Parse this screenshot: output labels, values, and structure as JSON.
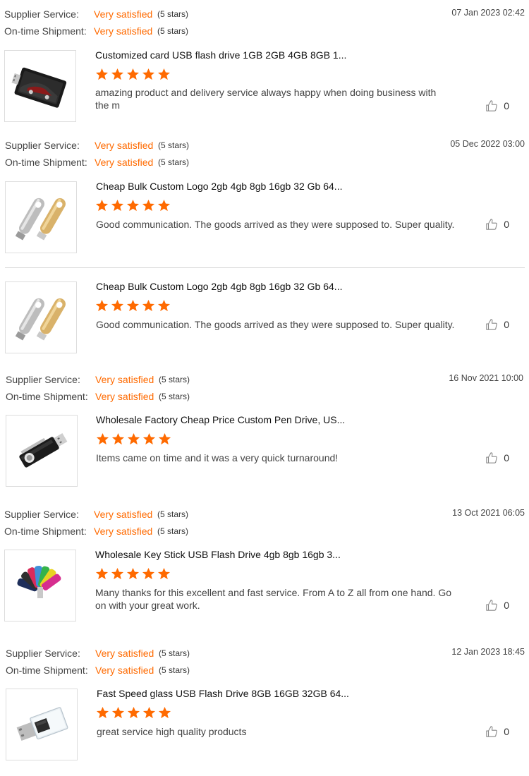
{
  "labels": {
    "supplier_service": "Supplier Service:",
    "ontime_shipment": "On-time Shipment:"
  },
  "reviews": [
    {
      "supplier_service": "Very satisfied",
      "supplier_stars": "(5 stars)",
      "shipment": "Very satisfied",
      "shipment_stars": "(5 stars)",
      "date": "07 Jan 2023 02:42",
      "title": "Customized card USB flash drive 1GB 2GB 4GB 8GB 1...",
      "comment": "amazing product and delivery service always happy when doing business with the m",
      "likes": "0",
      "rating": 5,
      "image": "card-usb-image"
    },
    {
      "supplier_service": "Very satisfied",
      "supplier_stars": "(5 stars)",
      "shipment": "Very satisfied",
      "shipment_stars": "(5 stars)",
      "date": "05 Dec 2022 03:00",
      "title": "Cheap Bulk Custom Logo 2gb 4gb 8gb 16gb 32 Gb 64...",
      "comment": "Good communication. The goods arrived as they were supposed to. Super quality.",
      "likes": "0",
      "rating": 5,
      "image": "metal-keychain-usb-image"
    },
    {
      "title": "Cheap Bulk Custom Logo 2gb 4gb 8gb 16gb 32 Gb 64...",
      "comment": "Good communication. The goods arrived as they were supposed to. Super quality.",
      "likes": "0",
      "rating": 5,
      "image": "metal-keychain-usb-image"
    },
    {
      "supplier_service": "Very satisfied",
      "supplier_stars": "(5 stars)",
      "shipment": "Very satisfied",
      "shipment_stars": "(5 stars)",
      "date": "16 Nov 2021 10:00",
      "title": "Wholesale Factory Cheap Price Custom Pen Drive, US...",
      "comment": "Items came on time and it was a very quick turnaround!",
      "likes": "0",
      "rating": 5,
      "image": "swivel-usb-image"
    },
    {
      "supplier_service": "Very satisfied",
      "supplier_stars": "(5 stars)",
      "shipment": "Very satisfied",
      "shipment_stars": "(5 stars)",
      "date": "13 Oct 2021 06:05",
      "title": "Wholesale Key Stick USB Flash Drive 4gb 8gb 16gb 3...",
      "comment": "Many thanks for this excellent and fast service. From A to Z all from one hand. Go on with your great work.",
      "likes": "0",
      "rating": 5,
      "image": "colorful-key-usb-image"
    },
    {
      "supplier_service": "Very satisfied",
      "supplier_stars": "(5 stars)",
      "shipment": "Very satisfied",
      "shipment_stars": "(5 stars)",
      "date": "12 Jan 2023 18:45",
      "title": "Fast Speed glass USB Flash Drive 8GB 16GB 32GB 64...",
      "comment": "great service high quality products",
      "likes": "0",
      "rating": 5,
      "image": "glass-usb-image"
    }
  ],
  "colors": {
    "accent": "#ff6a00",
    "star": "#ff6a00",
    "divider": "#d9d9d9"
  }
}
